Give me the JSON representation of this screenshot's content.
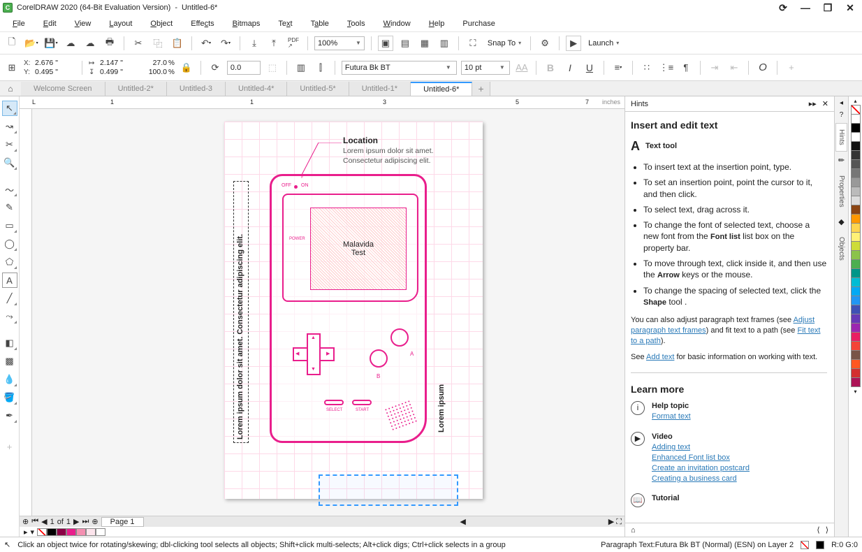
{
  "titlebar": {
    "app": "CorelDRAW 2020 (64-Bit Evaluation Version)",
    "doc": "Untitled-6*"
  },
  "menu": [
    "File",
    "Edit",
    "View",
    "Layout",
    "Object",
    "Effects",
    "Bitmaps",
    "Text",
    "Table",
    "Tools",
    "Window",
    "Help",
    "Purchase"
  ],
  "toolbar1": {
    "zoom": "100%",
    "snap": "Snap To",
    "launch": "Launch"
  },
  "propbar": {
    "x": "2.676 \"",
    "y": "0.495 \"",
    "w": "2.147 \"",
    "h": "0.499 \"",
    "sx": "27.0",
    "sy": "100.0",
    "rot": "0.0",
    "font": "Futura Bk BT",
    "size": "10 pt"
  },
  "doctabs": [
    "Welcome Screen",
    "Untitled-2*",
    "Untitled-3",
    "Untitled-4*",
    "Untitled-5*",
    "Untitled-1*",
    "Untitled-6*"
  ],
  "doctab_active": 6,
  "ruler": {
    "unit": "inches",
    "start": -1,
    "marks": [
      -1,
      1,
      3,
      5,
      7
    ]
  },
  "artboard": {
    "loc_head": "Location",
    "loc_body1": "Lorem ipsum dolor sit amet.",
    "loc_body2": "Consectetur adipiscing elit.",
    "screen_line1": "Malavida",
    "screen_line2": "Test",
    "off": "OFF",
    "on": "ON",
    "power": "POWER",
    "select": "SELECT",
    "start": "START",
    "a": "A",
    "b": "B",
    "left_text": "Lorem ipsum dolor sit amet. Consectetur adipiscing elit.",
    "right_text": "Lorem ipsum"
  },
  "page_nav": {
    "cur": "1",
    "total": "1",
    "label": "Page 1",
    "of": "of"
  },
  "palette_row": [
    "#000",
    "#8b0045",
    "#e91e8c",
    "#f48fb1",
    "#fce4ec",
    "#fff"
  ],
  "hints": {
    "title": "Hints",
    "h": "Insert and edit text",
    "tool": "Text tool",
    "bullets": [
      "To insert text at the insertion point, type.",
      "To set an insertion point, point the cursor to it, and then click.",
      "To select text, drag across it.",
      "To change the font of selected text, choose a new font from the |Font list| list box on the property bar.",
      "To move through text, click inside it, and then use the |Arrow| keys or the mouse.",
      "To change the spacing of selected text, click the |Shape| tool ."
    ],
    "para1a": "You can also adjust paragraph text frames (see ",
    "para1link": "Adjust paragraph text frames",
    "para1b": ") and fit text to a path (see ",
    "para1link2": "Fit text to a path",
    "para1c": ").",
    "para2a": "See ",
    "para2link": "Add text",
    "para2b": " for basic information on working with text.",
    "learn": "Learn more",
    "help_h": "Help topic",
    "help_link": "Format text",
    "video_h": "Video",
    "video_links": [
      "Adding text",
      "Enhanced Font list box",
      "Create an invitation postcard",
      "Creating a business card"
    ],
    "tut_h": "Tutorial"
  },
  "docks": [
    "Hints",
    "Properties",
    "Objects"
  ],
  "colors": [
    "#fff",
    "#000",
    "#fff",
    "#111",
    "#333",
    "#555",
    "#777",
    "#999",
    "#bbb",
    "#ddd",
    "#8b4513",
    "#ff9800",
    "#ffd54f",
    "#fff176",
    "#cddc39",
    "#8bc34a",
    "#4caf50",
    "#009688",
    "#00bcd4",
    "#03a9f4",
    "#2196f3",
    "#3f51b5",
    "#673ab7",
    "#9c27b0",
    "#e91e63",
    "#f44336",
    "#795548",
    "#ff5722",
    "#d32f2f",
    "#ad1457"
  ],
  "status": {
    "hint": "Click an object twice for rotating/skewing; dbl-clicking tool selects all objects; Shift+click multi-selects; Alt+click digs; Ctrl+click selects in a group",
    "obj": "Paragraph Text:Futura Bk BT (Normal) (ESN) on Layer 2",
    "rgb": "R:0 G:0"
  }
}
